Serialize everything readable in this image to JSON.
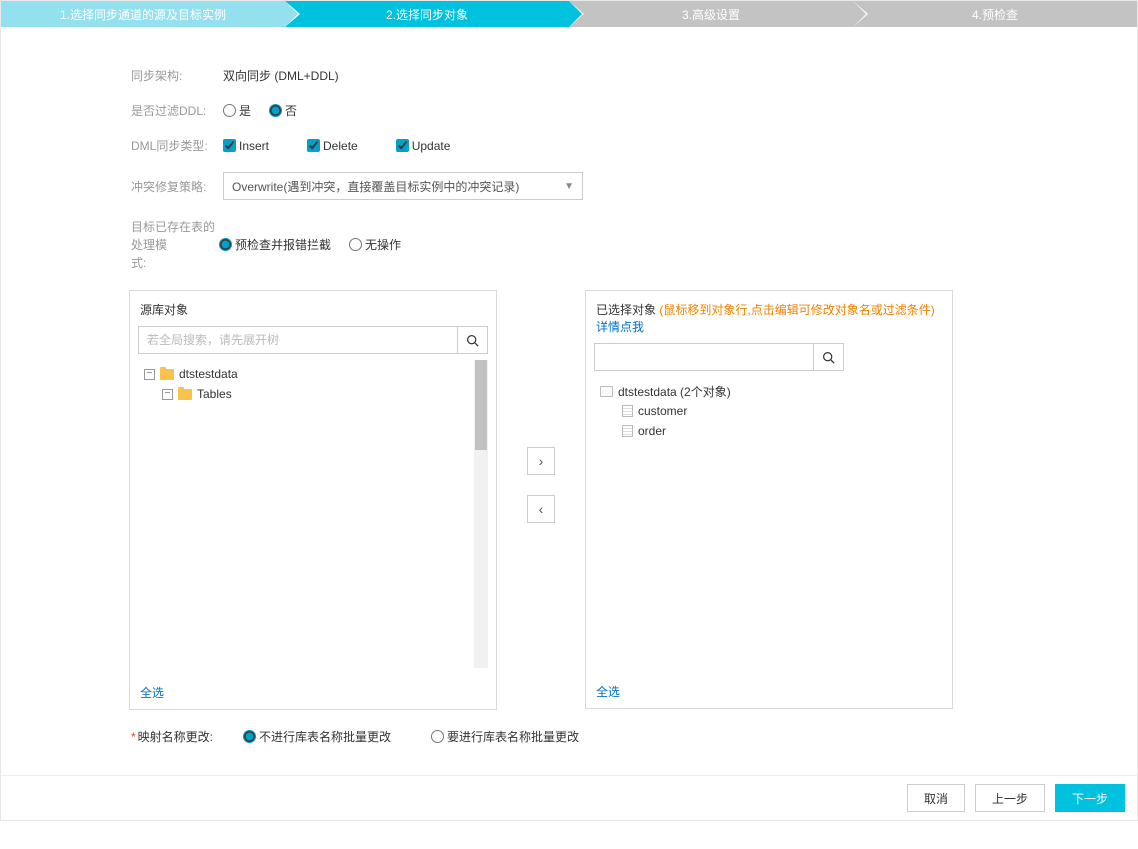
{
  "steps": [
    {
      "label": "1.选择同步通道的源及目标实例",
      "state": "done"
    },
    {
      "label": "2.选择同步对象",
      "state": "active"
    },
    {
      "label": "3.高级设置",
      "state": ""
    },
    {
      "label": "4.预检查",
      "state": ""
    }
  ],
  "form": {
    "arch_label": "同步架构:",
    "arch_value": "双向同步 (DML+DDL)",
    "filter_ddl_label": "是否过滤DDL:",
    "filter_ddl_yes": "是",
    "filter_ddl_no": "否",
    "dml_label": "DML同步类型:",
    "dml_insert": "Insert",
    "dml_delete": "Delete",
    "dml_update": "Update",
    "conflict_label": "冲突修复策略:",
    "conflict_value": "Overwrite(遇到冲突，直接覆盖目标实例中的冲突记录)",
    "existing_label_l1": "目标已存在表的处理模",
    "existing_label_l2": "式:",
    "existing_opt1": "预检查并报错拦截",
    "existing_opt2": "无操作"
  },
  "source_panel": {
    "title": "源库对象",
    "search_placeholder": "若全局搜索，请先展开树",
    "tree": {
      "root": "dtstestdata",
      "child": "Tables"
    },
    "select_all": "全选"
  },
  "target_panel": {
    "title": "已选择对象",
    "hint": "(鼠标移到对象行,点击编辑可修改对象名或过滤条件)",
    "detail_link": "详情点我",
    "tree": {
      "db": "dtstestdata (2个对象)",
      "t1": "customer",
      "t2": "order"
    },
    "select_all": "全选"
  },
  "mapping": {
    "label": "映射名称更改:",
    "opt1": "不进行库表名称批量更改",
    "opt2": "要进行库表名称批量更改"
  },
  "footer": {
    "cancel": "取消",
    "prev": "上一步",
    "next": "下一步"
  }
}
